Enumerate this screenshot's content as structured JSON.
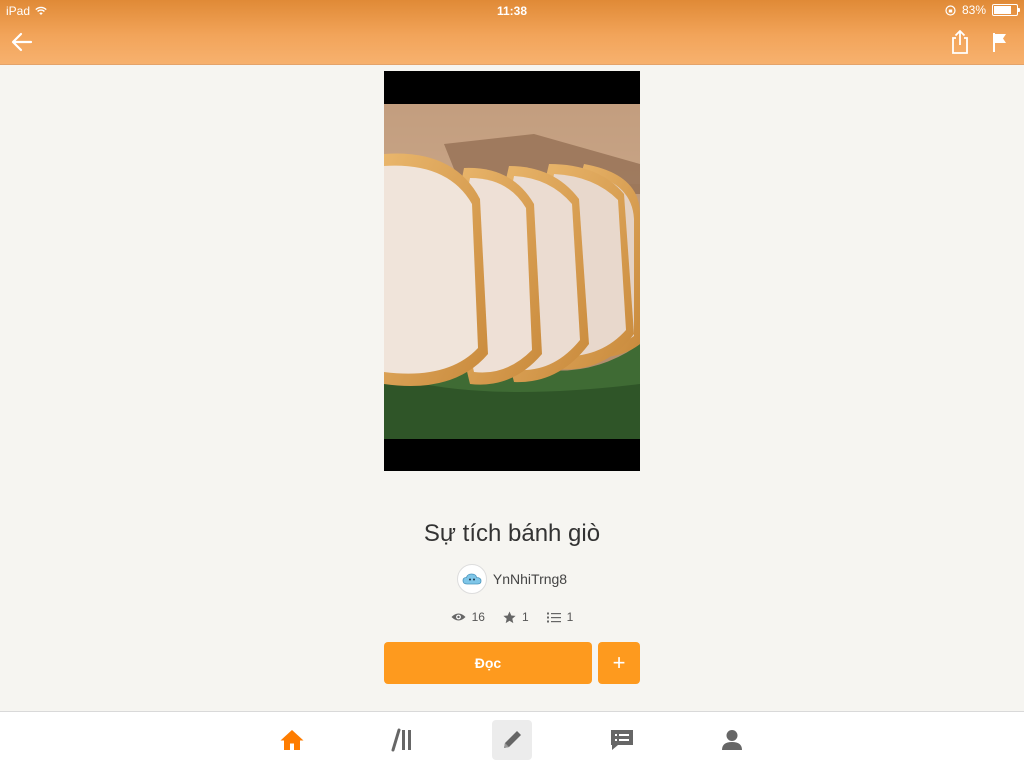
{
  "status_bar": {
    "carrier": "iPad",
    "time": "11:38",
    "battery_percent": "83%",
    "battery_level": 0.83
  },
  "nav": {
    "back_icon": "arrow-left-icon",
    "share_icon": "share-icon",
    "flag_icon": "flag-icon"
  },
  "story": {
    "title": "Sự tích bánh giò",
    "author": "YnNhiTrng8",
    "stats": {
      "views": "16",
      "votes": "1",
      "parts": "1"
    }
  },
  "actions": {
    "read_label": "Đọc",
    "add_label": "+"
  },
  "tabbar": {
    "items": [
      "home-icon",
      "library-icon",
      "write-icon",
      "messages-icon",
      "profile-icon"
    ],
    "active": "home",
    "accent_color": "#fe7c00"
  },
  "colors": {
    "header": "#f2a45a",
    "button": "#fe9a1e",
    "background": "#f6f5f1"
  }
}
